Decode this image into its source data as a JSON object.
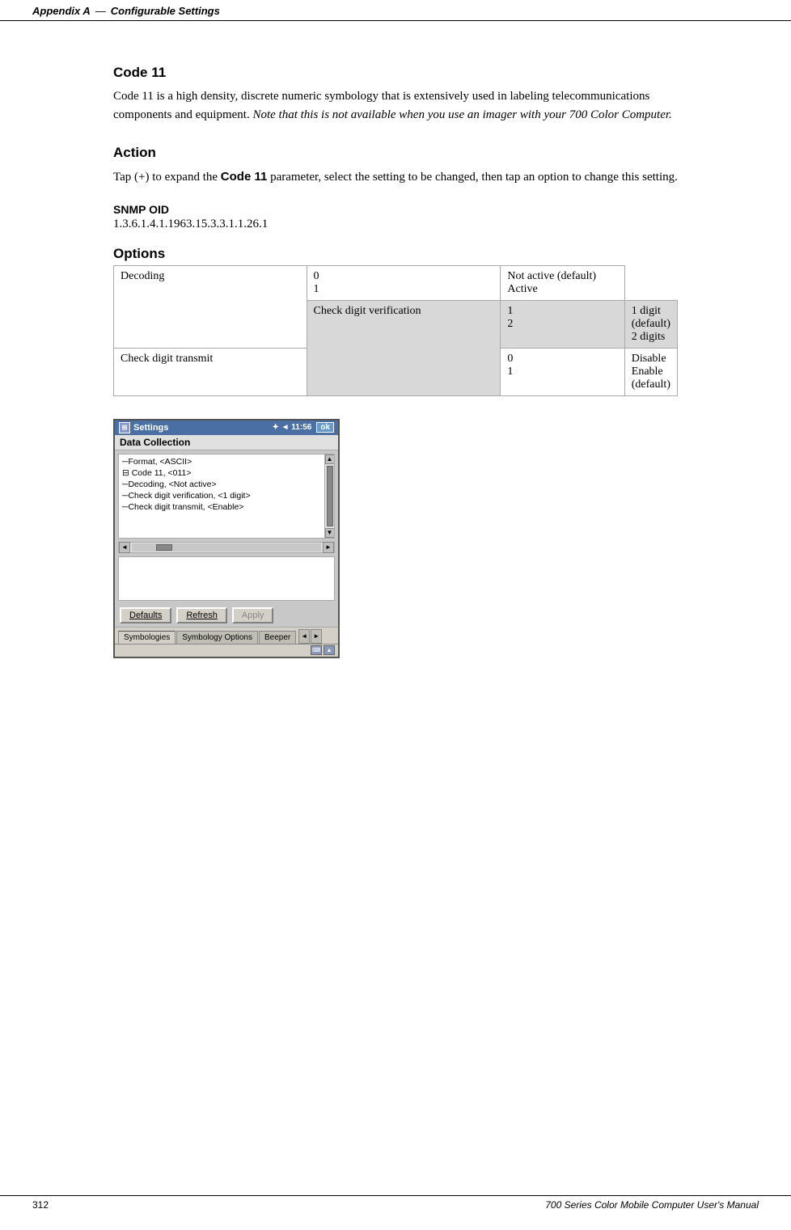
{
  "header": {
    "appendix": "Appendix A",
    "dash": "—",
    "title": "Configurable Settings"
  },
  "section": {
    "code11_title": "Code 11",
    "code11_body1": "Code 11 is a high density, discrete numeric symbology that is extensively used in labeling telecommunications components and equipment.",
    "code11_note": "Note that this is not available when you use an imager with your 700 Color Computer.",
    "action_title": "Action",
    "action_body": "Tap (+) to expand the Code 11 parameter, select the setting to be changed, then tap an option to change this setting.",
    "action_bold": "Code 11",
    "snmp_title": "SNMP OID",
    "snmp_value": "1.3.6.1.4.1.1963.15.3.3.1.1.26.1",
    "options_title": "Options"
  },
  "options_table": {
    "rows": [
      {
        "name": "Decoding",
        "values": "0\n1",
        "descriptions": "Not active (default)\nActive"
      },
      {
        "name": "Check digit verification",
        "values": "1\n2",
        "descriptions": "1 digit (default)\n2 digits"
      },
      {
        "name": "Check digit transmit",
        "values": "0\n1",
        "descriptions": "Disable\nEnable (default)"
      }
    ]
  },
  "device": {
    "titlebar_icon": "⊞",
    "titlebar_label": "Settings",
    "titlebar_status": "✦ ◄ 11:56",
    "titlebar_ok": "ok",
    "subheader": "Data Collection",
    "tree_lines": [
      "    ─Format, <ASCII>",
      "⊟ Code 11, <011>",
      "    ─Decoding, <Not active>",
      "    ─Check digit verification, <1 digit>",
      "    ─Check digit transmit, <Enable>"
    ],
    "btn_defaults": "Defaults",
    "btn_refresh": "Refresh",
    "btn_apply": "Apply",
    "tabs": [
      "Symbologies",
      "Symbology Options",
      "Beeper"
    ],
    "tab_arrow_left": "◄",
    "tab_arrow_right": "►"
  },
  "footer": {
    "page_number": "312",
    "title": "700 Series Color Mobile Computer User's Manual"
  }
}
